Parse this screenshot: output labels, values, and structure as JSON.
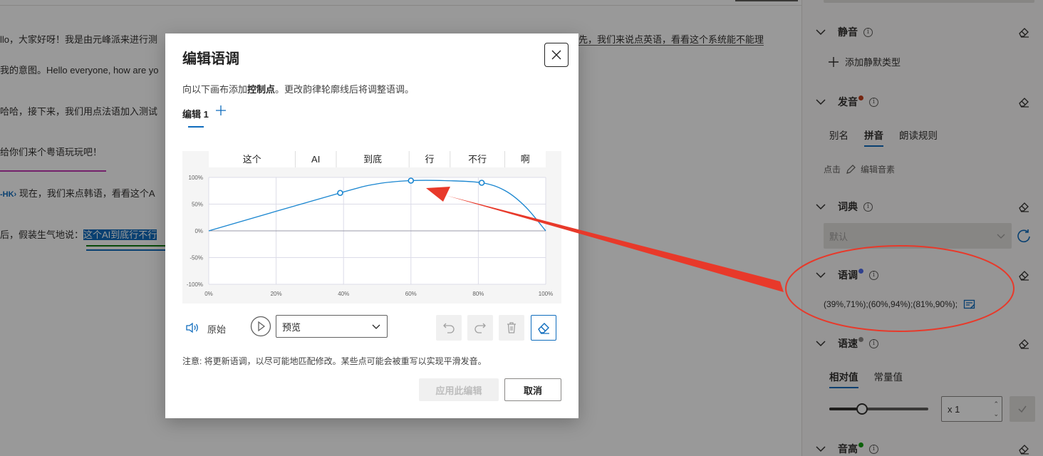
{
  "editor": {
    "line1_a": "llo，大家好呀！我是由元峰派来进行测",
    "line1_b": "先，我们来说点英语，看看这个系统能不能理",
    "line2": "我的意图。Hello everyone, how are yo",
    "line3": "哈哈，接下来，我们用点法语加入测试",
    "line4": "给你们来个粤语玩玩吧！",
    "line5_tag": "-HK›",
    "line5": "现在，我们来点韩语，看看这个A",
    "line6_pre": "后，假装生气地说：",
    "line6_sel": "这个AI到底行不行"
  },
  "dialog": {
    "title": "编辑语调",
    "desc_pre": "向以下画布添加",
    "desc_bold": "控制点",
    "desc_post": "。更改韵律轮廓线后将调整语调。",
    "tab_label": "编辑 1",
    "original_label": "原始",
    "preview_value": "预览",
    "note": "注意: 将更新语调，以尽可能地匹配修改。某些点可能会被重写以实现平滑发音。",
    "apply_label": "应用此编辑",
    "cancel_label": "取消"
  },
  "chart_data": {
    "type": "line",
    "segments": [
      "这个",
      "AI",
      "到底",
      "行",
      "不行",
      "啊"
    ],
    "x_ticks": [
      "0%",
      "20%",
      "40%",
      "60%",
      "80%",
      "100%"
    ],
    "y_ticks": [
      "100%",
      "50%",
      "0%",
      "-50%",
      "-100%"
    ],
    "xlim": [
      0,
      100
    ],
    "ylim": [
      -100,
      100
    ],
    "control_points": [
      {
        "x": 39,
        "y": 71
      },
      {
        "x": 60,
        "y": 94
      },
      {
        "x": 81,
        "y": 90
      }
    ],
    "curve": [
      [
        0,
        0
      ],
      [
        39,
        71
      ],
      [
        50,
        88
      ],
      [
        60,
        94
      ],
      [
        70,
        94
      ],
      [
        81,
        90
      ],
      [
        88,
        75
      ],
      [
        94,
        45
      ],
      [
        100,
        0
      ]
    ],
    "grid": true,
    "colors": {
      "line": "#1a86d0",
      "grid": "#dcdce8"
    }
  },
  "panel": {
    "mute_title": "静音",
    "add_mute": "添加静默类型",
    "pron_title": "发音",
    "pron_tabs": [
      "别名",
      "拼音",
      "朗读规则"
    ],
    "pron_active": "拼音",
    "click_label": "点击",
    "edit_phoneme": "编辑音素",
    "dict_title": "词典",
    "dict_value": "默认",
    "pitch_title": "语调",
    "pitch_value": "(39%,71%);(60%,94%);(81%,90%);",
    "rate_title": "语速",
    "rate_tabs": [
      "相对值",
      "常量值"
    ],
    "rate_active": "相对值",
    "rate_value": "x 1",
    "rate_slider": 0.33,
    "pitch2_title": "音高",
    "dot_colors": {
      "pron": "#c43e1c",
      "pitch": "#4f6bed",
      "rate": "#8a8886",
      "pitch2": "#13a10e"
    }
  },
  "annotation": {
    "color": "#e8392a"
  }
}
